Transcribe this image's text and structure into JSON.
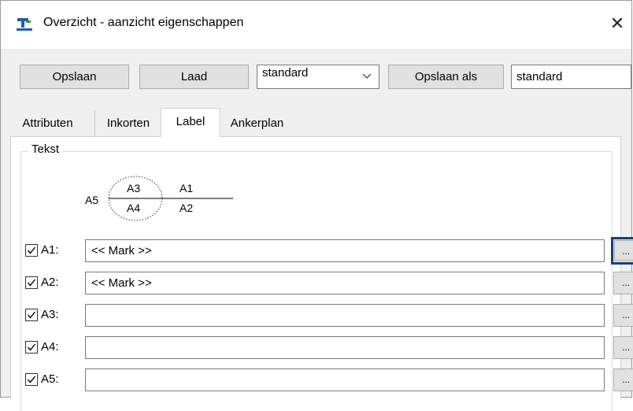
{
  "window": {
    "title": "Overzicht - aanzicht eigenschappen",
    "close": "✕"
  },
  "toolbar": {
    "save_label": "Opslaan",
    "load_label": "Laad",
    "preset_select_value": "standard",
    "save_as_label": "Opslaan als",
    "save_as_name": "standard"
  },
  "tabs": [
    {
      "label": "Attributen",
      "active": false
    },
    {
      "label": "Inkorten",
      "active": false
    },
    {
      "label": "Label",
      "active": true
    },
    {
      "label": "Ankerplan",
      "active": false
    }
  ],
  "text_group": {
    "title": "Tekst",
    "diagram": {
      "a1": "A1",
      "a2": "A2",
      "a3": "A3",
      "a4": "A4",
      "a5": "A5"
    },
    "rows": [
      {
        "label": "A1:",
        "checked": true,
        "value": "<< Mark >>",
        "button": "..."
      },
      {
        "label": "A2:",
        "checked": true,
        "value": "<< Mark >>",
        "button": "..."
      },
      {
        "label": "A3:",
        "checked": true,
        "value": "",
        "button": "..."
      },
      {
        "label": "A4:",
        "checked": true,
        "value": "",
        "button": "..."
      },
      {
        "label": "A5:",
        "checked": true,
        "value": "",
        "button": "..."
      }
    ]
  },
  "colors": {
    "focus_border": "#1c3f7a",
    "icon_blue": "#1f5fa8",
    "icon_green": "#2e9b3a"
  }
}
